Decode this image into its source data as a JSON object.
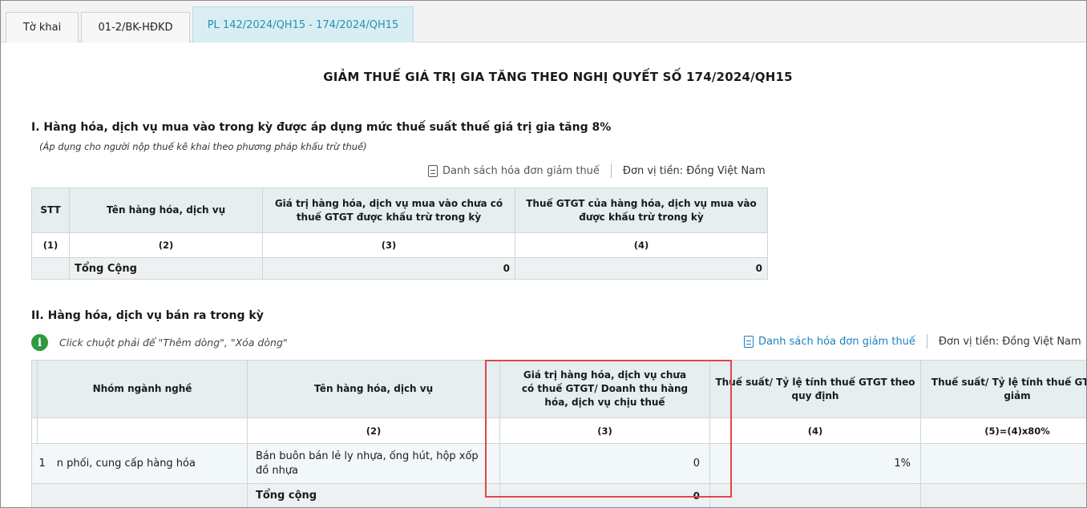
{
  "tabs": [
    {
      "label": "Tờ khai"
    },
    {
      "label": "01-2/BK-HĐKD"
    },
    {
      "label": "PL 142/2024/QH15 - 174/2024/QH15"
    }
  ],
  "page_title": "GIẢM THUẾ GIÁ TRỊ GIA TĂNG THEO NGHỊ QUYẾT SỐ 174/2024/QH15",
  "section1": {
    "heading": "I. Hàng hóa, dịch vụ mua vào trong kỳ được áp dụng mức thuế suất thuế giá trị gia tăng 8%",
    "note": "(Áp dụng cho người nộp thuế kê khai theo phương pháp khấu trừ thuế)",
    "invoice_link": "Danh sách hóa đơn giảm thuế",
    "currency": "Đơn vị tiền: Đồng Việt Nam",
    "headers": [
      "STT",
      "Tên hàng hóa, dịch vụ",
      "Giá trị hàng hóa, dịch vụ mua vào chưa có thuế GTGT được khấu trừ trong kỳ",
      "Thuế GTGT của hàng hóa, dịch vụ mua vào được khấu trừ trong kỳ"
    ],
    "index_row": [
      "(1)",
      "(2)",
      "(3)",
      "(4)"
    ],
    "total_label": "Tổng Cộng",
    "total_values": [
      "0",
      "0"
    ]
  },
  "section2": {
    "heading": "II. Hàng hóa, dịch vụ bán ra trong kỳ",
    "hint": "Click chuột phải để \"Thêm dòng\", \"Xóa dòng\"",
    "invoice_link": "Danh sách hóa đơn giảm thuế",
    "currency": "Đơn vị tiền: Đồng Việt Nam",
    "headers": [
      "Nhóm ngành nghề",
      "Tên hàng hóa, dịch vụ",
      "Giá trị hàng hóa, dịch vụ chưa có thuế GTGT/ Doanh thu hàng hóa, dịch vụ chịu thuế",
      "Thuế suất/ Tỷ lệ tính thuế GTGT theo quy định",
      "Thuế suất/ Tỷ lệ tính thuế GTGT giảm"
    ],
    "index_row": [
      "",
      "(2)",
      "(3)",
      "(4)",
      "(5)=(4)x80%"
    ],
    "rows": [
      {
        "stt": "1",
        "group": "n phối, cung cấp hàng hóa",
        "name": "Bán buôn bán lẻ ly nhựa, ống hút, hộp xốp đồ nhựa",
        "value": "0",
        "rate": "1%",
        "reduced": ""
      }
    ],
    "total_label": "Tổng cộng",
    "total_value": "0"
  }
}
